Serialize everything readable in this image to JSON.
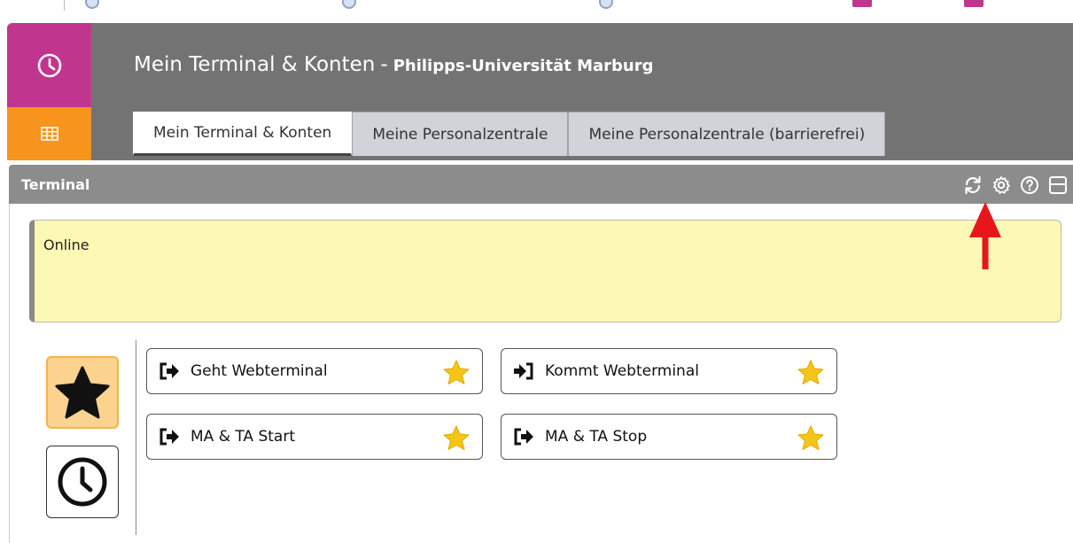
{
  "header": {
    "title": "Mein Terminal & Konten",
    "separator": "-",
    "subtitle": "Philipps-Universität Marburg",
    "side_icons": [
      "clock-icon",
      "grid-icon"
    ],
    "colors": {
      "side_top": "#c0368f",
      "side_bottom": "#f7941d",
      "bar": "#737373"
    }
  },
  "tabs": [
    {
      "label": "Mein Terminal & Konten",
      "active": true
    },
    {
      "label": "Meine Personalzentrale",
      "active": false
    },
    {
      "label": "Meine Personalzentrale (barrierefrei)",
      "active": false
    }
  ],
  "panel": {
    "title": "Terminal",
    "icons": [
      "refresh-icon",
      "gear-icon",
      "help-icon",
      "window-icon"
    ]
  },
  "status": {
    "text": "Online",
    "color": "#fdf8b4"
  },
  "annotation": {
    "arrow_color": "#e8161b",
    "points_to": "gear-icon"
  },
  "sidebar": {
    "buttons": [
      {
        "icon": "star-icon",
        "selected": true
      },
      {
        "icon": "clock-icon",
        "selected": false
      }
    ]
  },
  "terminal_buttons": [
    {
      "label": "Geht Webterminal",
      "icon": "sign-out-icon",
      "favorite": true
    },
    {
      "label": "Kommt Webterminal",
      "icon": "sign-in-icon",
      "favorite": true
    },
    {
      "label": "MA & TA Start",
      "icon": "sign-out-icon",
      "favorite": true
    },
    {
      "label": "MA & TA Stop",
      "icon": "sign-out-icon",
      "favorite": true
    }
  ],
  "star_color": "#f5c518"
}
